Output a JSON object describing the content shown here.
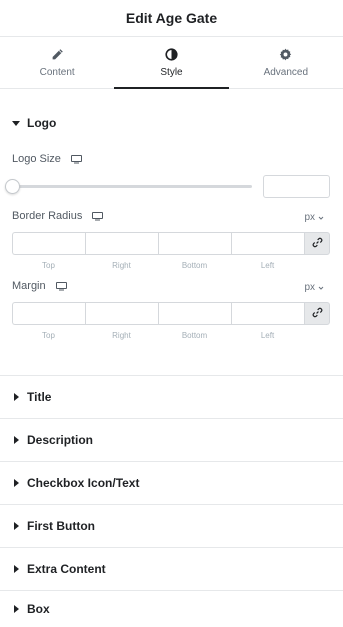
{
  "header": {
    "title": "Edit Age Gate"
  },
  "tabs": [
    {
      "label": "Content",
      "icon": "pencil-icon",
      "active": false
    },
    {
      "label": "Style",
      "icon": "contrast-icon",
      "active": true
    },
    {
      "label": "Advanced",
      "icon": "gear-icon",
      "active": false
    }
  ],
  "logo_section": {
    "title": "Logo",
    "logo_size": {
      "label": "Logo Size",
      "value": ""
    },
    "border_radius": {
      "label": "Border Radius",
      "unit": "px",
      "fields": [
        "Top",
        "Right",
        "Bottom",
        "Left"
      ],
      "values": [
        "",
        "",
        "",
        ""
      ]
    },
    "margin": {
      "label": "Margin",
      "unit": "px",
      "fields": [
        "Top",
        "Right",
        "Bottom",
        "Left"
      ],
      "values": [
        "",
        "",
        "",
        ""
      ]
    }
  },
  "collapsed_sections": [
    {
      "title": "Title"
    },
    {
      "title": "Description"
    },
    {
      "title": "Checkbox Icon/Text"
    },
    {
      "title": "First Button"
    },
    {
      "title": "Extra Content"
    },
    {
      "title": "Box"
    }
  ],
  "colors": {
    "text": "#1f2124",
    "muted": "#69727d",
    "border": "#e6e8ea",
    "input_border": "#d5d8dc"
  }
}
